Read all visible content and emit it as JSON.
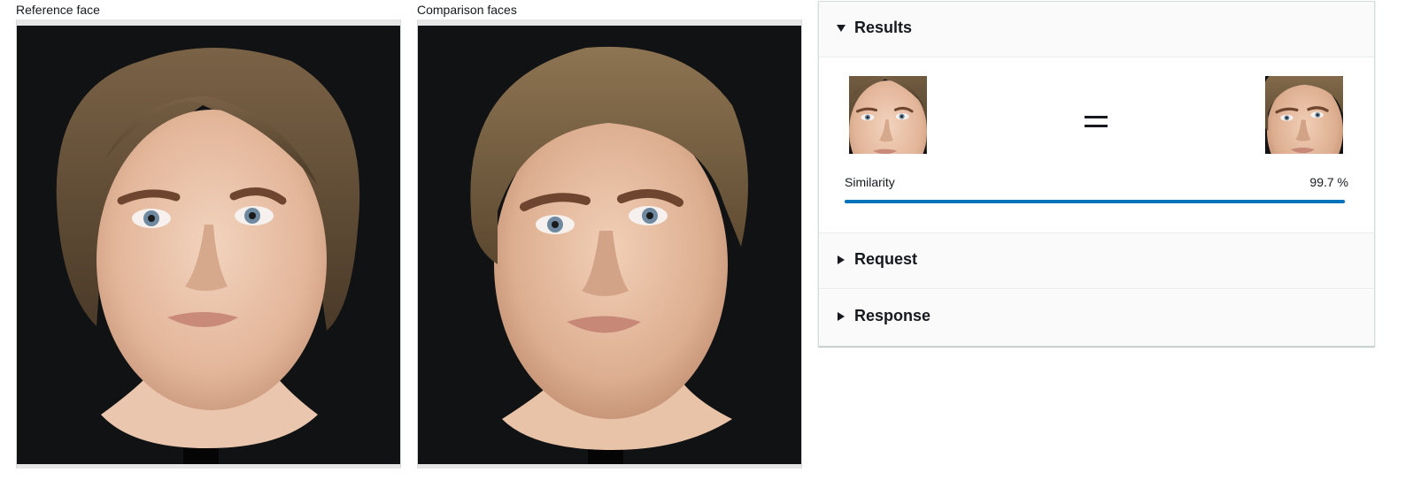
{
  "reference_panel": {
    "title": "Reference face",
    "image": "mannequin-head-reference"
  },
  "comparison_panel": {
    "title": "Comparison faces",
    "image": "mannequin-head-comparison"
  },
  "results": {
    "header": "Results",
    "expanded": true,
    "reference_thumbnail": "reference-face-crop",
    "comparison_thumbnail": "comparison-face-crop",
    "match_symbol": "equals-icon",
    "similarity_label": "Similarity",
    "similarity_value": "99.7 %",
    "similarity_fraction": 0.997
  },
  "request": {
    "header": "Request",
    "expanded": false
  },
  "response": {
    "header": "Response",
    "expanded": false
  },
  "colors": {
    "accent": "#0073bb",
    "photo_background": "#111213",
    "text": "#16191f"
  }
}
